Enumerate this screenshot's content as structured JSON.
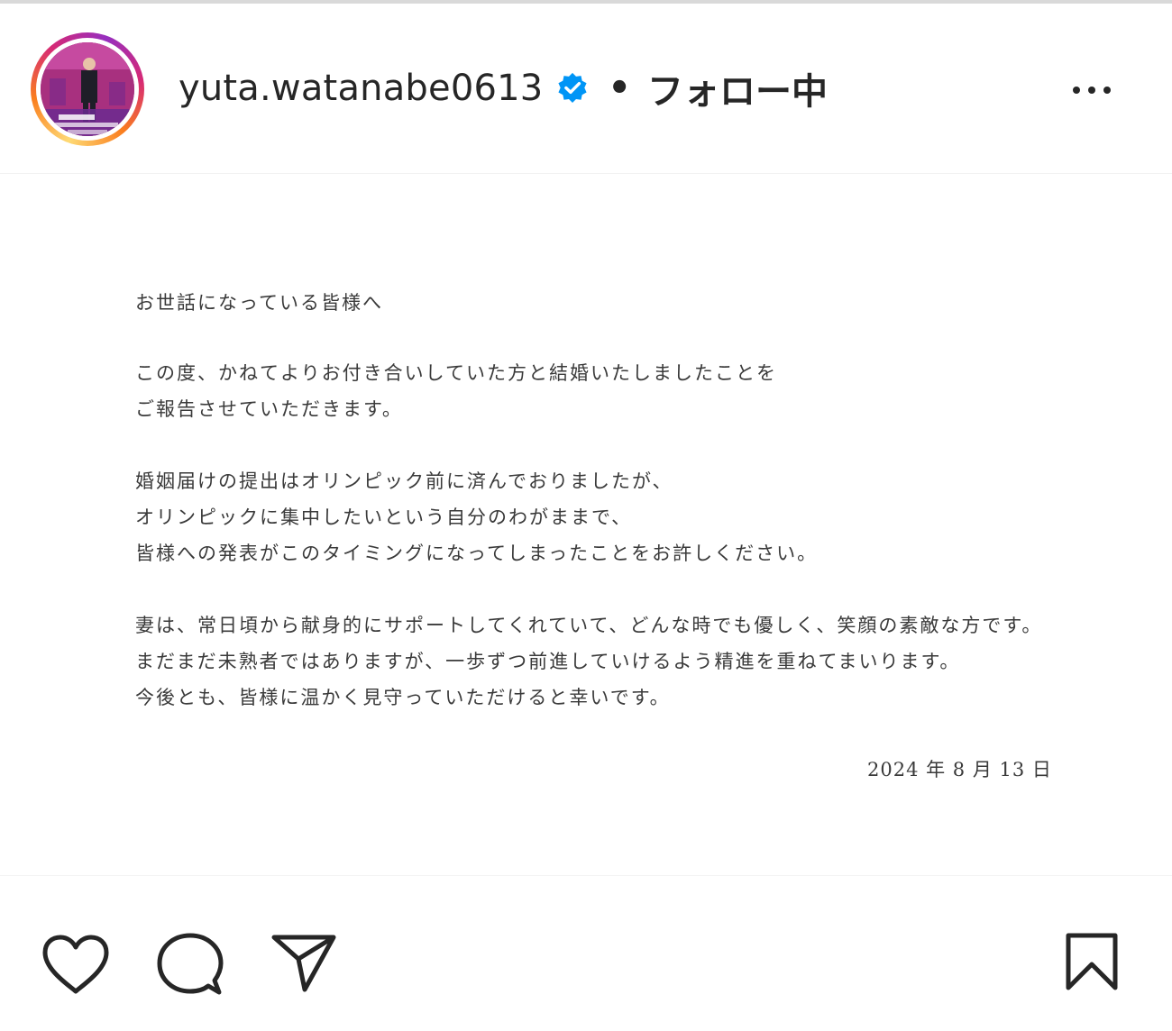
{
  "header": {
    "username": "yuta.watanabe0613",
    "separator": "•",
    "follow_status": "フォロー中",
    "verified_color": "#0095f6"
  },
  "post": {
    "letter": {
      "greeting": "お世話になっている皆様へ",
      "paragraph1": [
        "この度、かねてよりお付き合いしていた方と結婚いたしましたことを",
        "ご報告させていただきます。"
      ],
      "paragraph2": [
        "婚姻届けの提出はオリンピック前に済んでおりましたが、",
        "オリンピックに集中したいという自分のわがままで、",
        "皆様への発表がこのタイミングになってしまったことをお許しください。"
      ],
      "paragraph3": [
        "妻は、常日頃から献身的にサポートしてくれていて、どんな時でも優しく、笑顔の素敵な方です。",
        "まだまだ未熟者ではありますが、一歩ずつ前進していけるよう精進を重ねてまいります。",
        "今後とも、皆様に温かく見守っていただけると幸いです。"
      ],
      "date": "2024 年 8 月 13 日"
    }
  },
  "actions": {
    "icons": [
      "heart-icon",
      "comment-icon",
      "share-icon",
      "bookmark-icon"
    ]
  }
}
